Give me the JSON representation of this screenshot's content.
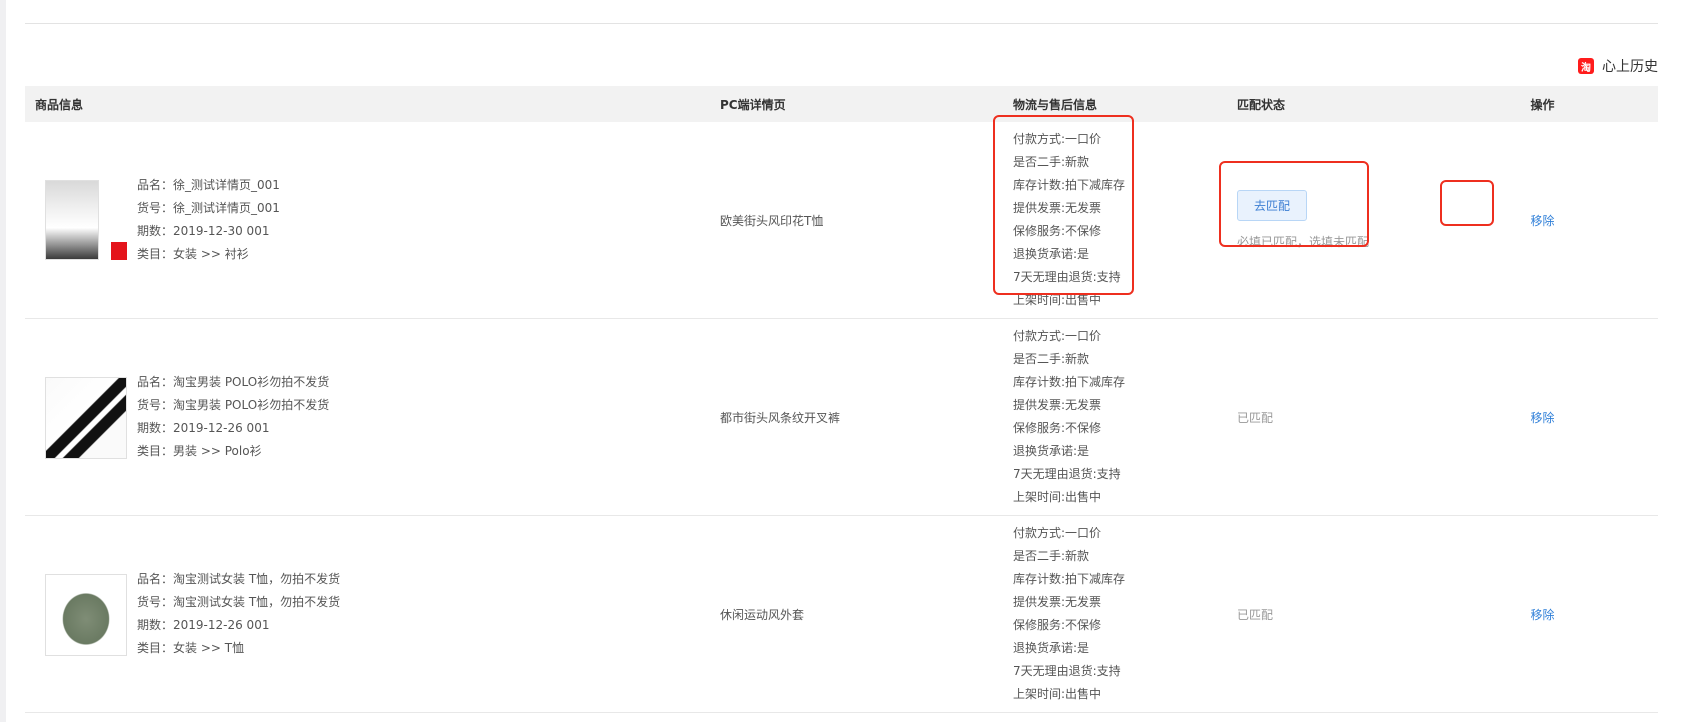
{
  "shop": {
    "icon": "taobao-logo-icon",
    "logo_text": "淘",
    "name": "心上历史"
  },
  "table": {
    "headers": [
      "商品信息",
      "PC端详情页",
      "物流与售后信息",
      "匹配状态",
      "操作"
    ],
    "rows": [
      {
        "thumb": "product-photo-woman-shirt",
        "name": "品名：徐_测试详情页_001",
        "code": "货号：徐_测试详情页_001",
        "period": "期数：2019-12-30 001",
        "category": "类目：女装 >> 衬衫",
        "pc": "欧美街头风印花T恤",
        "logistics": [
          "付款方式:一口价",
          "是否二手:新款",
          "库存计数:拍下减库存",
          "提供发票:无发票",
          "保修服务:不保修",
          "退换货承诺:是",
          "7天无理由退货:支持",
          "上架时间:出售中"
        ],
        "status": {
          "type": "unmatched",
          "button": "去匹配",
          "tip": "必填已匹配，选填未匹配"
        },
        "action": "移除"
      },
      {
        "thumb": "product-photo-polo",
        "name": "品名：淘宝男装 POLO衫勿拍不发货",
        "code": "货号：淘宝男装 POLO衫勿拍不发货",
        "period": "期数：2019-12-26 001",
        "category": "类目：男装 >> Polo衫",
        "pc": "都市街头风条纹开叉裤",
        "logistics": [
          "付款方式:一口价",
          "是否二手:新款",
          "库存计数:拍下减库存",
          "提供发票:无发票",
          "保修服务:不保修",
          "退换货承诺:是",
          "7天无理由退货:支持",
          "上架时间:出售中"
        ],
        "status": {
          "type": "matched",
          "text": "已匹配"
        },
        "action": "移除"
      },
      {
        "thumb": "product-photo-coat",
        "name": "品名：淘宝测试女装 T恤，勿拍不发货",
        "code": "货号：淘宝测试女装 T恤，勿拍不发货",
        "period": "期数：2019-12-26 001",
        "category": "类目：女装 >> T恤",
        "pc": "休闲运动风外套",
        "logistics": [
          "付款方式:一口价",
          "是否二手:新款",
          "库存计数:拍下减库存",
          "提供发票:无发票",
          "保修服务:不保修",
          "退换货承诺:是",
          "7天无理由退货:支持",
          "上架时间:出售中"
        ],
        "status": {
          "type": "matched",
          "text": "已匹配"
        },
        "action": "移除"
      }
    ]
  },
  "colors": {
    "highlight": "#ee2f1f",
    "link": "#2f7fd8"
  }
}
